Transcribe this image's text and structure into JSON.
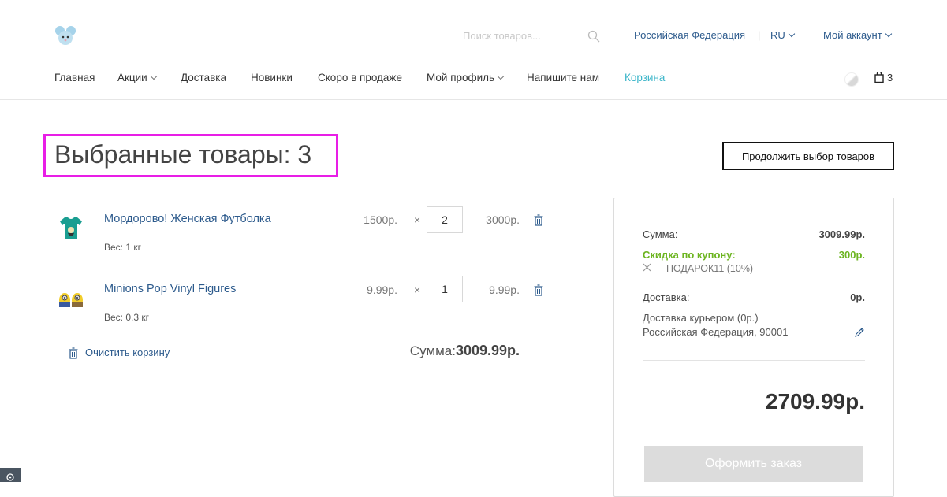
{
  "header": {
    "search_placeholder": "Поиск товаров...",
    "region": "Российская Федерация",
    "language": "RU",
    "account": "Мой аккаунт",
    "cart_count": "3"
  },
  "nav": [
    {
      "label": "Главная"
    },
    {
      "label": "Акции"
    },
    {
      "label": "Доставка"
    },
    {
      "label": "Новинки"
    },
    {
      "label": "Скоро в продаже"
    },
    {
      "label": "Мой профиль"
    },
    {
      "label": "Напишите нам"
    },
    {
      "label": "Корзина"
    }
  ],
  "page": {
    "title": "Выбранные товары: 3",
    "continue_button": "Продолжить выбор товаров"
  },
  "items": [
    {
      "name": "Мордорово! Женская Футболка",
      "weight": "Вес: 1 кг",
      "price": "1500р.",
      "times": "×",
      "qty": "2",
      "total": "3000р."
    },
    {
      "name": "Minions Pop Vinyl Figures",
      "weight": "Вес: 0.3 кг",
      "price": "9.99р.",
      "times": "×",
      "qty": "1",
      "total": "9.99р."
    }
  ],
  "cart": {
    "clear_label": "Очистить корзину",
    "sum_label": "Сумма:",
    "sum_value": "3009.99р."
  },
  "summary": {
    "sum_label": "Сумма:",
    "sum_value": "3009.99р.",
    "discount_label": "Скидка по купону:",
    "discount_value": "300р.",
    "coupon": "ПОДАРОК11 (10%)",
    "delivery_label": "Доставка:",
    "delivery_value": "0р.",
    "delivery_method": "Доставка курьером (0р.)",
    "delivery_address": "Российская Федерация, 90001",
    "grand_total": "2709.99р.",
    "checkout_button": "Оформить заказ"
  },
  "colors": {
    "link": "#2c5a8c",
    "active_nav": "#3ab5c9",
    "highlight": "#e81ee6",
    "discount": "#6db521"
  }
}
